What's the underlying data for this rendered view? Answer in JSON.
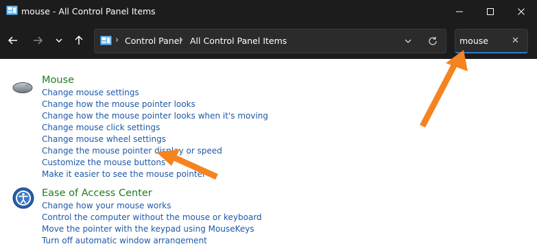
{
  "window": {
    "title": "mouse - All Control Panel Items"
  },
  "navigation": {
    "breadcrumbs": [
      "Control Panel",
      "All Control Panel Items"
    ],
    "search_value": "mouse",
    "icons": [
      "back-arrow-icon",
      "forward-arrow-icon",
      "chevron-down-icon",
      "up-arrow-icon",
      "refresh-icon",
      "close-icon"
    ]
  },
  "results": [
    {
      "title": "Mouse",
      "icon": "mouse-icon",
      "links": [
        "Change mouse settings",
        "Change how the mouse pointer looks",
        "Change how the mouse pointer looks when it's moving",
        "Change mouse click settings",
        "Change mouse wheel settings",
        "Change the mouse pointer display or speed",
        "Customize the mouse buttons",
        "Make it easier to see the mouse pointer"
      ]
    },
    {
      "title": "Ease of Access Center",
      "icon": "ease-of-access-icon",
      "links": [
        "Change how your mouse works",
        "Control the computer without the mouse or keyboard",
        "Move the pointer with the keypad using MouseKeys",
        "Turn off automatic window arrangement"
      ]
    }
  ],
  "colors": {
    "titlebar": "#1c1c1c",
    "group_title": "#1f7a1f",
    "link": "#1c58a8",
    "annotation_arrow": "#f5831f"
  }
}
